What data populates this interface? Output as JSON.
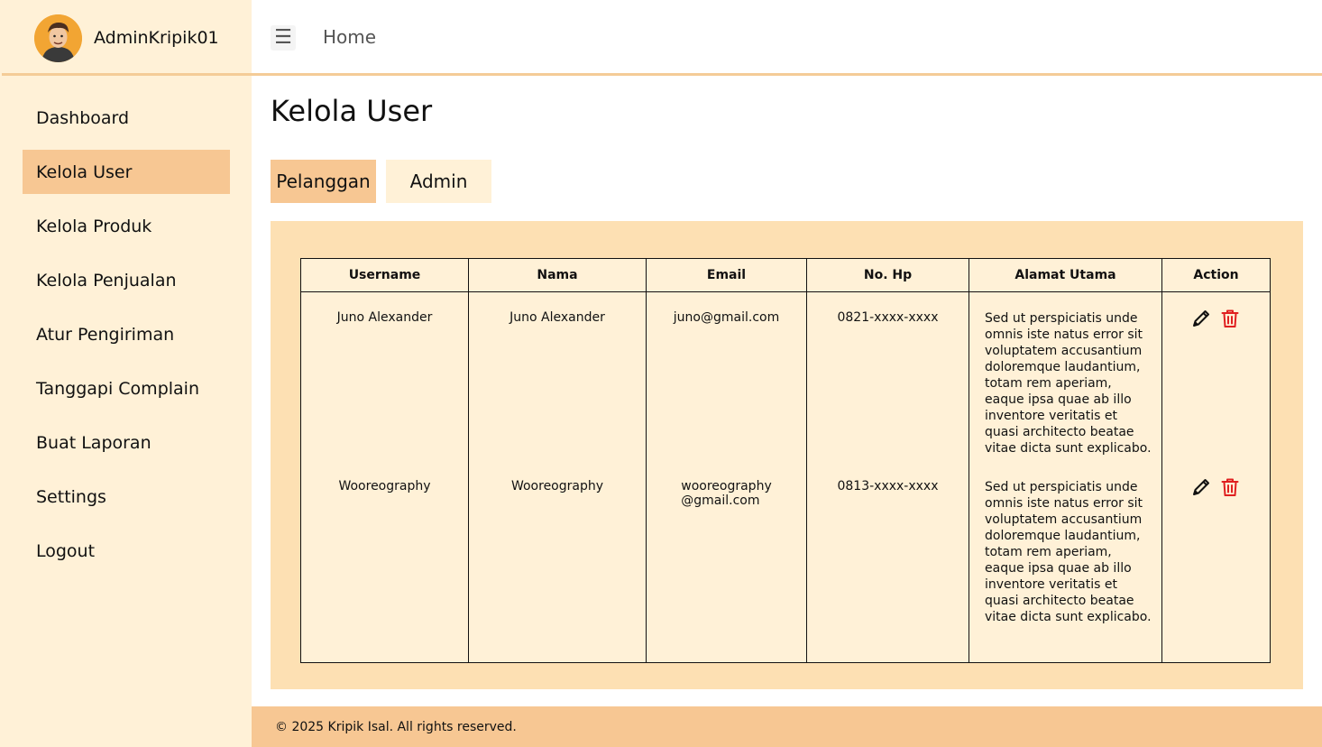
{
  "sidebar": {
    "profile_name": "AdminKripik01",
    "items": [
      {
        "label": "Dashboard"
      },
      {
        "label": "Kelola User"
      },
      {
        "label": "Kelola Produk"
      },
      {
        "label": "Kelola Penjualan"
      },
      {
        "label": "Atur Pengiriman"
      },
      {
        "label": "Tanggapi Complain"
      },
      {
        "label": "Buat Laporan"
      },
      {
        "label": "Settings"
      },
      {
        "label": "Logout"
      }
    ],
    "active_item": "Kelola User"
  },
  "topbar": {
    "menu_icon": "☰",
    "home_label": "Home"
  },
  "main": {
    "title": "Kelola User",
    "tabs": [
      {
        "label": "Pelanggan"
      },
      {
        "label": "Admin"
      }
    ],
    "active_tab": "Pelanggan"
  },
  "table": {
    "headers": [
      "Username",
      "Nama",
      "Email",
      "No. Hp",
      "Alamat Utama",
      "Action"
    ],
    "rows": [
      {
        "username": "Juno Alexander",
        "nama": "Juno Alexander",
        "email": "juno@gmail.com",
        "phone": "0821-xxxx-xxxx",
        "address": "Sed ut perspiciatis unde omnis iste natus error sit voluptatem  accusantium doloremque laudantium, totam rem aperiam, eaque ipsa quae ab illo inventore veritatis et quasi architecto beatae vitae dicta sunt  explicabo."
      },
      {
        "username": "Wooreography",
        "nama": "Wooreography",
        "email_line1": "wooreography",
        "email_line2": "@gmail.com",
        "phone": "0813-xxxx-xxxx",
        "address": "Sed ut perspiciatis unde omnis iste natus error sit voluptatem  accusantium doloremque laudantium, totam rem aperiam, eaque ipsa quae ab illo inventore veritatis et quasi architecto beatae vitae dicta sunt  explicabo."
      }
    ],
    "action_icons": [
      "pencil-icon",
      "trash-icon"
    ]
  },
  "footer": {
    "text": "© 2025 Kripik Isal. All rights reserved."
  },
  "colors": {
    "sidebar_bg": "#fff1d7",
    "accent": "#f7c793",
    "panel_bg": "#fde0b3",
    "delete": "#e02020"
  }
}
